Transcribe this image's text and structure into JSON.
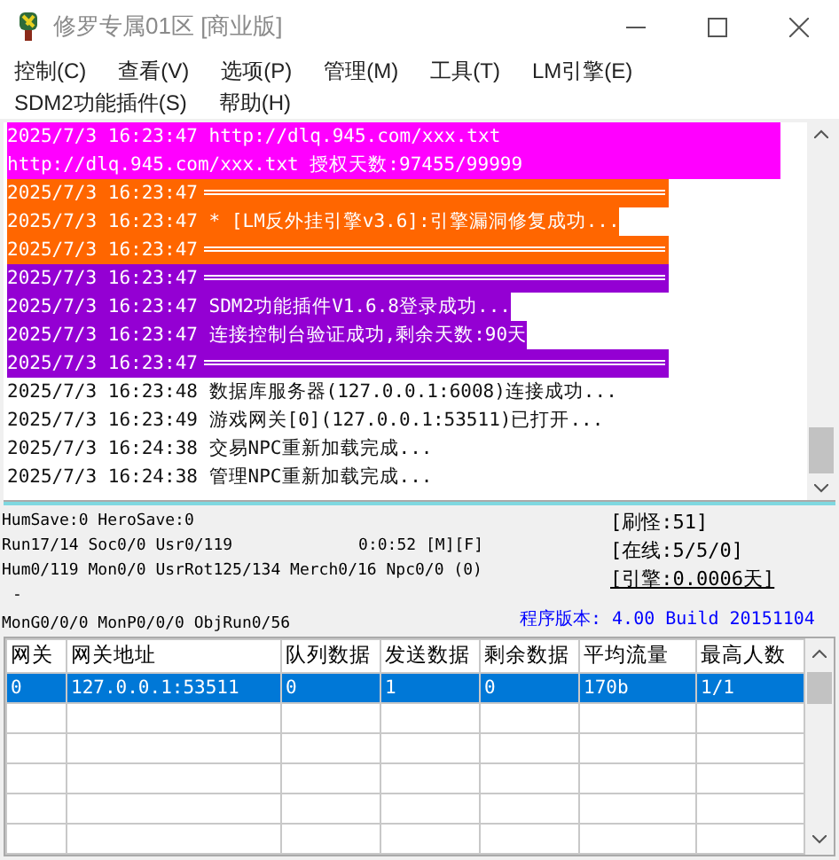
{
  "window": {
    "title": "修罗专属01区 [商业版]"
  },
  "menu": [
    "控制(C)",
    "查看(V)",
    "选项(P)",
    "管理(M)",
    "工具(T)",
    "LM引擎(E)",
    "SDM2功能插件(S)",
    "帮助(H)"
  ],
  "log": [
    {
      "kind": "text",
      "time": "2025/7/3 16:23:47",
      "message": "http://dlq.945.com/xxx.txt http://dlq.945.com/xxx.txt 授权天数:97455/99999",
      "color": "#ff00ff"
    },
    {
      "kind": "rule",
      "time": "2025/7/3 16:23:47",
      "color": "#ff6600"
    },
    {
      "kind": "text",
      "time": "2025/7/3 16:23:47",
      "message": "* [LM反外挂引擎v3.6]:引擎漏洞修复成功...",
      "color": "#ff6600"
    },
    {
      "kind": "rule",
      "time": "2025/7/3 16:23:47",
      "color": "#ff6600"
    },
    {
      "kind": "rule",
      "time": "2025/7/3 16:23:47",
      "color": "#9400d3"
    },
    {
      "kind": "text",
      "time": "2025/7/3 16:23:47",
      "message": "SDM2功能插件V1.6.8登录成功...",
      "color": "#9400d3"
    },
    {
      "kind": "text",
      "time": "2025/7/3 16:23:47",
      "message": "连接控制台验证成功,剩余天数:90天",
      "color": "#9400d3"
    },
    {
      "kind": "rule",
      "time": "2025/7/3 16:23:47",
      "color": "#9400d3"
    },
    {
      "kind": "text",
      "time": "2025/7/3 16:23:48",
      "message": "数据库服务器(127.0.0.1:6008)连接成功..."
    },
    {
      "kind": "text",
      "time": "2025/7/3 16:23:49",
      "message": "游戏网关[0](127.0.0.1:53511)已打开..."
    },
    {
      "kind": "text",
      "time": "2025/7/3 16:24:38",
      "message": "交易NPC重新加载完成..."
    },
    {
      "kind": "text",
      "time": "2025/7/3 16:24:38",
      "message": "管理NPC重新加载完成..."
    }
  ],
  "status": {
    "line_1": "HumSave:0 HeroSave:0",
    "line_2": "Run17/14 Soc0/0 Usr0/119",
    "uptime": "0:0:52 [M][F]",
    "line_3": "Hum0/119 Mon0/0 UsrRot125/134 Merch0/16 Npc0/0 (0)",
    "line_4": "-",
    "line_5": "MonG0/0/0 MonP0/0/0 ObjRun0/56",
    "counters": [
      "[刷怪:51]",
      "[在线:5/5/0]",
      "[引擎:0.0006天]"
    ],
    "version": "程序版本: 4.00 Build 20151104"
  },
  "table": {
    "columns": [
      "网关",
      "网关地址",
      "队列数据",
      "发送数据",
      "剩余数据",
      "平均流量",
      "最高人数"
    ],
    "rows": [
      {
        "cells": [
          "0",
          "127.0.0.1:53511",
          "0",
          "1",
          "0",
          "170b",
          "1/1"
        ],
        "selected": true
      }
    ]
  }
}
